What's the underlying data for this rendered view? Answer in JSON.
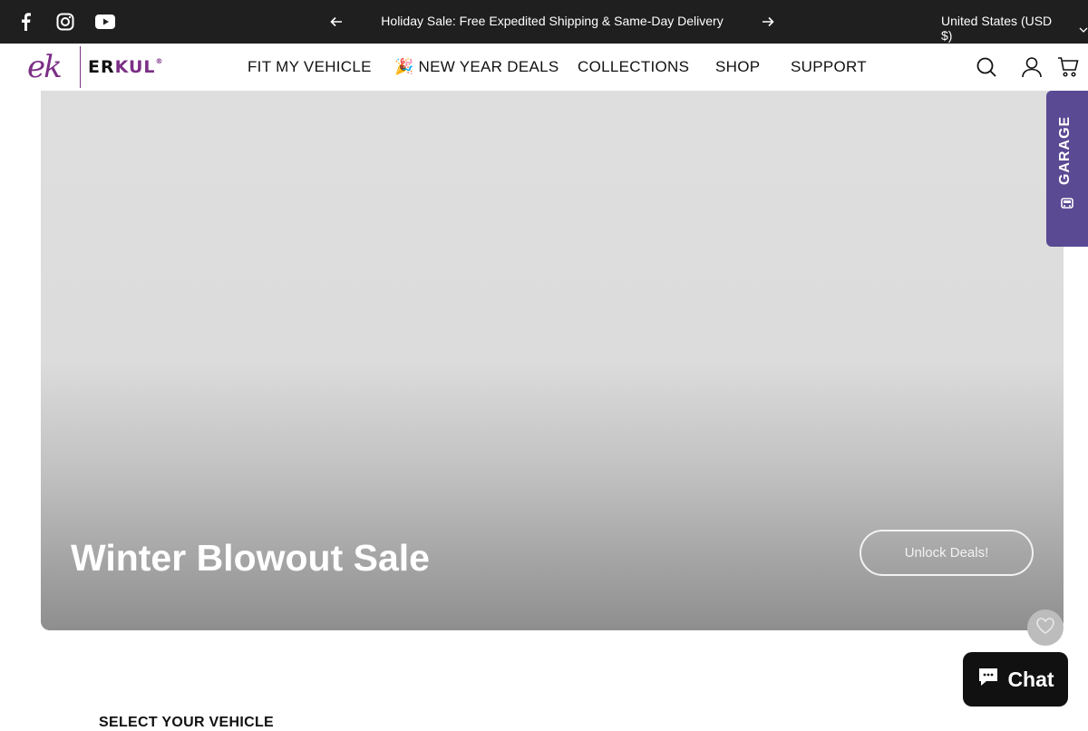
{
  "topbar": {
    "social": [
      {
        "name": "facebook-icon"
      },
      {
        "name": "instagram-icon"
      },
      {
        "name": "youtube-icon"
      }
    ],
    "announcement": "Holiday Sale: Free Expedited Shipping & Same-Day Delivery",
    "currency": "United States (USD $)"
  },
  "header": {
    "logo": {
      "script": "ek",
      "word_a": "ER",
      "word_b": "KUL",
      "reg": "®"
    },
    "nav": [
      {
        "label": "FIT MY VEHICLE"
      },
      {
        "label": "🎉 NEW YEAR DEALS"
      },
      {
        "label": "COLLECTIONS"
      },
      {
        "label": "SHOP"
      },
      {
        "label": "SUPPORT"
      }
    ]
  },
  "hero": {
    "title": "Winter Blowout Sale",
    "button": "Unlock Deals!"
  },
  "garage": {
    "label": "GARAGE"
  },
  "chat": {
    "label": "Chat"
  },
  "vehicle": {
    "title": "SELECT YOUR VEHICLE"
  },
  "colors": {
    "topbar_bg": "#1f1f1f",
    "brand_purple": "#7b2f86",
    "garage_bg": "#5a4a93"
  }
}
